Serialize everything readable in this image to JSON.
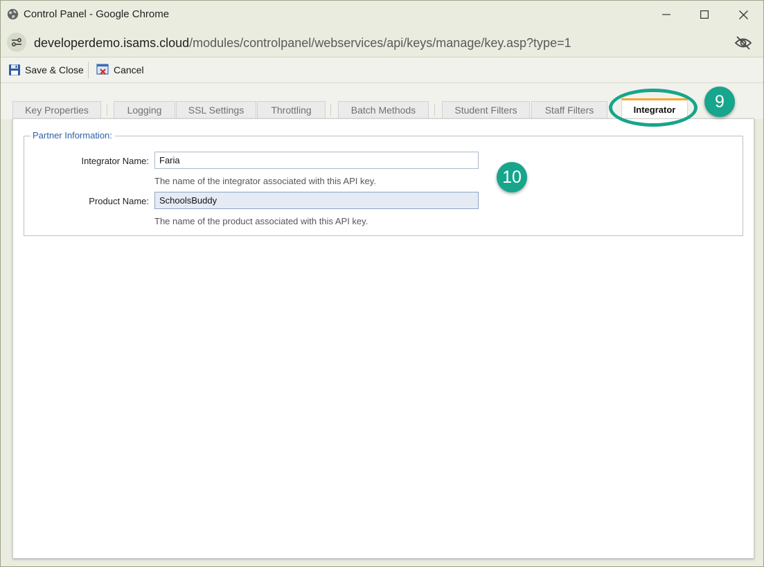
{
  "window": {
    "title": "Control Panel - Google Chrome"
  },
  "address": {
    "host": "developerdemo.isams.cloud",
    "path": "/modules/controlpanel/webservices/api/keys/manage/key.asp?type=1"
  },
  "toolbar": {
    "save_label": "Save & Close",
    "cancel_label": "Cancel"
  },
  "tabs": [
    {
      "label": "Key Properties"
    },
    {
      "label": "Logging"
    },
    {
      "label": "SSL Settings"
    },
    {
      "label": "Throttling"
    },
    {
      "label": "Batch Methods"
    },
    {
      "label": "Student Filters"
    },
    {
      "label": "Staff Filters"
    },
    {
      "label": "Integrator",
      "active": true
    }
  ],
  "partner": {
    "legend": "Partner Information:",
    "integrator_name_label": "Integrator Name:",
    "integrator_name_value": "Faria",
    "integrator_name_hint": "The name of the integrator associated with this API key.",
    "product_name_label": "Product Name:",
    "product_name_value": "SchoolsBuddy",
    "product_name_hint": "The name of the product associated with this API key."
  },
  "callouts": {
    "step_9": "9",
    "step_10": "10"
  },
  "colors": {
    "accent_teal": "#17a58c",
    "active_tab_top": "#f4a82c",
    "legend_blue": "#2d5fa7"
  },
  "icons": [
    "globe-icon",
    "minimize-icon",
    "maximize-icon",
    "close-icon",
    "site-info-icon",
    "eye-off-icon",
    "floppy-disk-icon",
    "cancel-icon"
  ]
}
